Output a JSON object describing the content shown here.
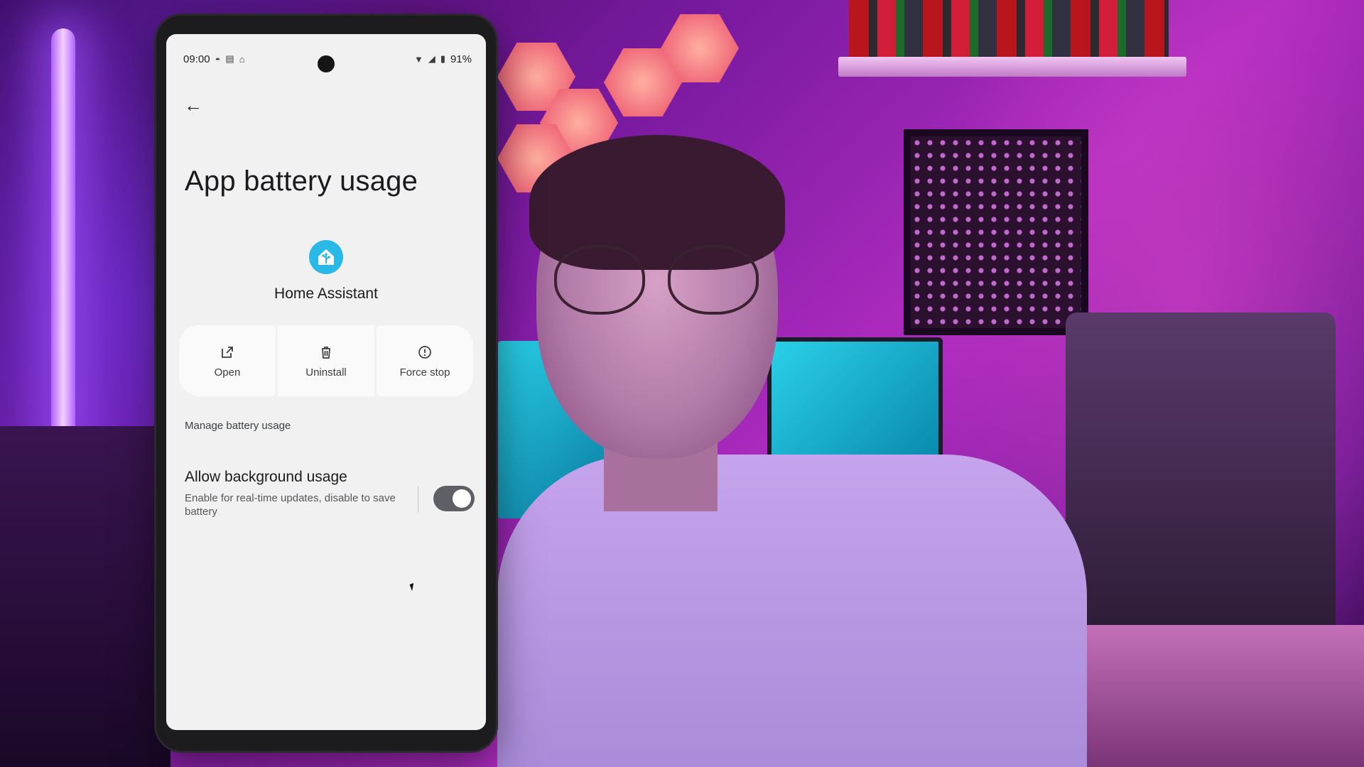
{
  "statusbar": {
    "time": "09:00",
    "battery": "91%",
    "icons": [
      "alarm-icon",
      "news-icon",
      "home-assistant-icon",
      "wifi-icon",
      "signal-icon",
      "battery-icon"
    ]
  },
  "page": {
    "title": "App battery usage"
  },
  "app": {
    "name": "Home Assistant",
    "icon": "home-assistant-logo",
    "brand_color": "#2ab8e6"
  },
  "actions": [
    {
      "label": "Open",
      "icon": "open-external-icon"
    },
    {
      "label": "Uninstall",
      "icon": "trash-icon"
    },
    {
      "label": "Force stop",
      "icon": "alert-circle-icon"
    }
  ],
  "section": {
    "label": "Manage battery usage"
  },
  "background_usage": {
    "title": "Allow background usage",
    "subtitle": "Enable for real-time updates, disable to save battery",
    "enabled": true
  }
}
